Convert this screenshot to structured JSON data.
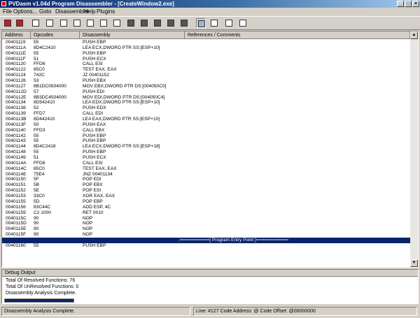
{
  "window": {
    "title": "PVDasm v1.04d Program Disassembler - [CreateWindow2.exe]"
  },
  "menu": [
    "File",
    "Options...",
    "Goto",
    "Disassembler",
    "Help",
    "Plugins"
  ],
  "toolbar": {
    "buttons": [
      "open-icon",
      "save-icon",
      "disassemble-icon",
      "goto-entry-icon",
      "goto-address-icon",
      "data-icon",
      "imports-icon",
      "exports-icon",
      "xrefs-icon",
      "strings-icon",
      "search-icon",
      "find-next-icon",
      "options-icon",
      "plugins-icon",
      "about-icon",
      "list-view-icon",
      "grid-view-icon",
      "tree-view-icon"
    ]
  },
  "listview": {
    "columns": [
      "Address",
      "Opcodes",
      "Disassembly",
      "References / Comments"
    ],
    "rows": [
      {
        "addr": "00401119",
        "op": "55",
        "dis": "PUSH EBP"
      },
      {
        "addr": "0040111A",
        "op": "8D4C2410",
        "dis": "LEA ECX,DWORD PTR SS:[ESP+10]"
      },
      {
        "addr": "0040111E",
        "op": "55",
        "dis": "PUSH EBP"
      },
      {
        "addr": "0040111F",
        "op": "51",
        "dis": "PUSH ECX"
      },
      {
        "addr": "00401120",
        "op": "FFD6",
        "dis": "CALL ESI"
      },
      {
        "addr": "00401122",
        "op": "85C0",
        "dis": "TEST EAX, EAX"
      },
      {
        "addr": "00401124",
        "op": "742C",
        "dis": "JZ 00401152"
      },
      {
        "addr": "00401126",
        "op": "53",
        "dis": "PUSH EBX"
      },
      {
        "addr": "00401127",
        "op": "8B1DC0504000",
        "dis": "MOV EBX,DWORD PTR DS:[004050C0]"
      },
      {
        "addr": "0040112D",
        "op": "57",
        "dis": "PUSH EDI"
      },
      {
        "addr": "0040112E",
        "op": "8B3DC4504000",
        "dis": "MOV EDI,DWORD PTR DS:[004050C4]"
      },
      {
        "addr": "00401134",
        "op": "8D542410",
        "dis": "LEA EDX,DWORD PTR SS:[ESP+10]"
      },
      {
        "addr": "00401138",
        "op": "52",
        "dis": "PUSH EDX"
      },
      {
        "addr": "00401139",
        "op": "FFD7",
        "dis": "CALL EDI"
      },
      {
        "addr": "0040113B",
        "op": "8D442410",
        "dis": "LEA EAX,DWORD PTR SS:[ESP+10]"
      },
      {
        "addr": "0040113F",
        "op": "50",
        "dis": "PUSH EAX"
      },
      {
        "addr": "00401140",
        "op": "FFD3",
        "dis": "CALL EBX"
      },
      {
        "addr": "00401142",
        "op": "55",
        "dis": "PUSH EBP"
      },
      {
        "addr": "00401143",
        "op": "55",
        "dis": "PUSH EBP"
      },
      {
        "addr": "00401144",
        "op": "8D4C2418",
        "dis": "LEA ECX,DWORD PTR SS:[ESP+18]"
      },
      {
        "addr": "00401148",
        "op": "55",
        "dis": "PUSH EBP"
      },
      {
        "addr": "00401149",
        "op": "51",
        "dis": "PUSH ECX"
      },
      {
        "addr": "0040114A",
        "op": "FFD6",
        "dis": "CALL ESI"
      },
      {
        "addr": "0040114C",
        "op": "85C0",
        "dis": "TEST EAX, EAX"
      },
      {
        "addr": "0040114E",
        "op": "75E4",
        "dis": "JNZ 00401134"
      },
      {
        "addr": "00401150",
        "op": "5F",
        "dis": "POP EDI"
      },
      {
        "addr": "00401151",
        "op": "5B",
        "dis": "POP EBX"
      },
      {
        "addr": "00401152",
        "op": "5E",
        "dis": "POP ESI"
      },
      {
        "addr": "00401153",
        "op": "33C0",
        "dis": "XOR EAX, EAX"
      },
      {
        "addr": "00401155",
        "op": "5D",
        "dis": "POP EBP"
      },
      {
        "addr": "00401156",
        "op": "83C44C",
        "dis": "ADD ESP, 4C"
      },
      {
        "addr": "00401159",
        "op": "C2 1000",
        "dis": "RET 0010"
      },
      {
        "addr": "0040115C",
        "op": "90",
        "dis": "NOP"
      },
      {
        "addr": "0040115D",
        "op": "90",
        "dis": "NOP"
      },
      {
        "addr": "0040115E",
        "op": "90",
        "dis": "NOP"
      },
      {
        "addr": "0040115F",
        "op": "90",
        "dis": "NOP"
      },
      {
        "addr": "",
        "op": "",
        "dis": "",
        "entry": ";===========[ Program Entry Point ]============"
      },
      {
        "addr": "00401160",
        "op": "55",
        "dis": "PUSH EBP"
      }
    ]
  },
  "debug": {
    "title": "Debug Output",
    "lines": [
      "Total Of Resolved Functions: 76",
      "Total Of UnResolved Functions: 0",
      "Disassembly Analysis Complete."
    ],
    "progress": 1.0
  },
  "status": {
    "left": "Disassembly Analysis Complete.",
    "right": "Line: #127 Code Address: @ Code Offset: @00000000"
  }
}
